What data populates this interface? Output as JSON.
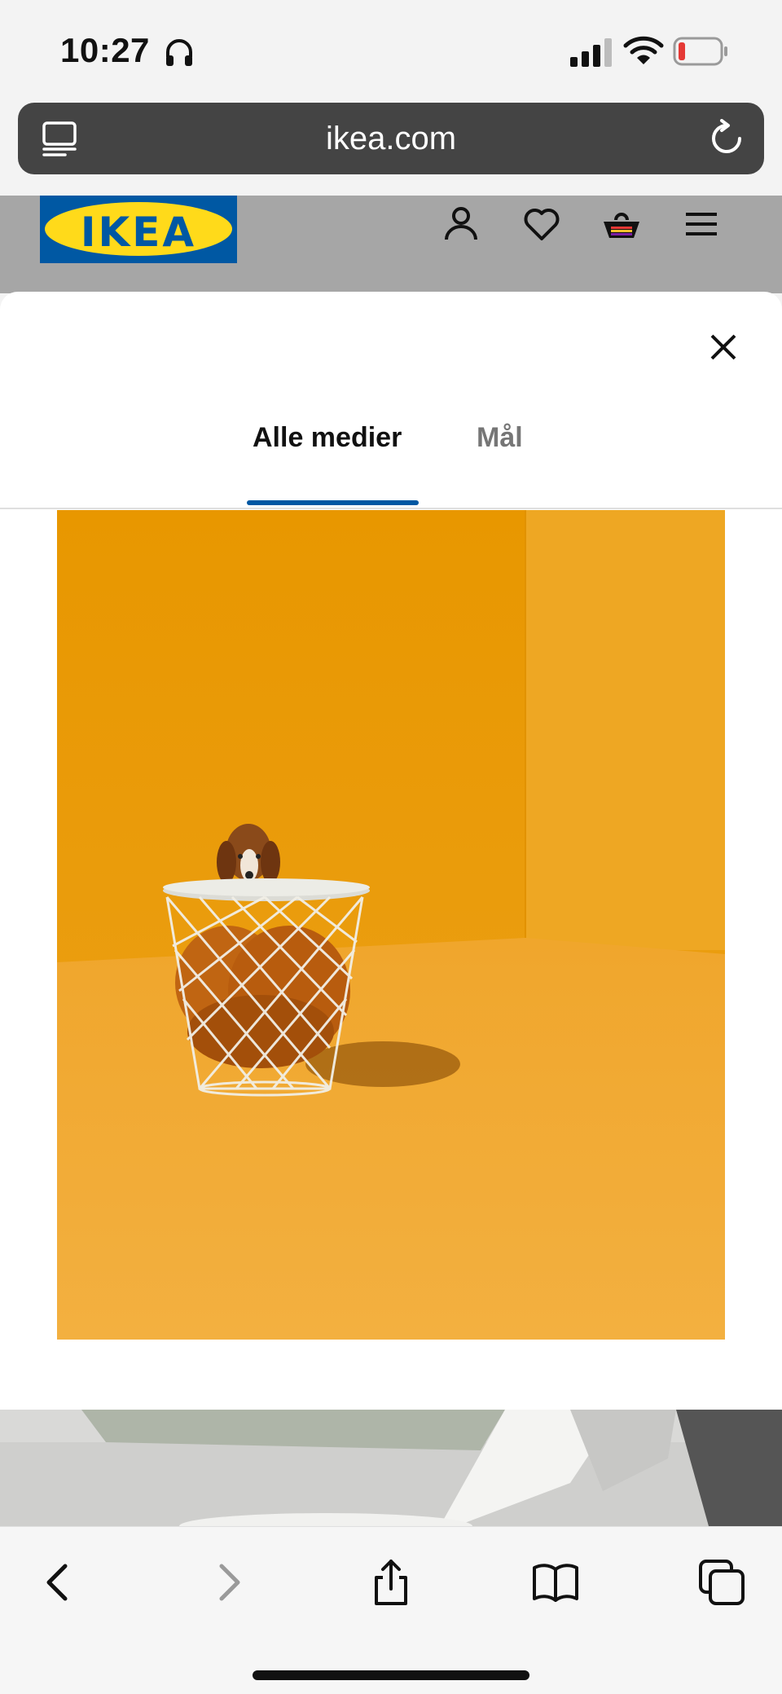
{
  "status_bar": {
    "time": "10:27",
    "icons": [
      "headphones-icon",
      "signal-icon",
      "wifi-icon",
      "battery-low-icon"
    ],
    "battery_color": "#e53935"
  },
  "browser": {
    "url": "ikea.com",
    "icons": [
      "reader-mode-icon",
      "reload-icon"
    ]
  },
  "site_header": {
    "logo_text": "IKEA",
    "brand_colors": {
      "blue": "#0058a3",
      "yellow": "#ffda1a"
    },
    "icons": [
      "account-icon",
      "wishlist-heart-icon",
      "shopping-bag-icon",
      "menu-icon"
    ]
  },
  "modal": {
    "tabs": [
      {
        "label": "Alle medier",
        "active": true
      },
      {
        "label": "Mål",
        "active": false
      }
    ],
    "accent_color": "#0058a3",
    "close_icon": "close-icon"
  },
  "toolbar": {
    "icons": [
      "back-icon",
      "forward-icon",
      "share-icon",
      "bookmarks-icon",
      "tabs-icon"
    ]
  }
}
